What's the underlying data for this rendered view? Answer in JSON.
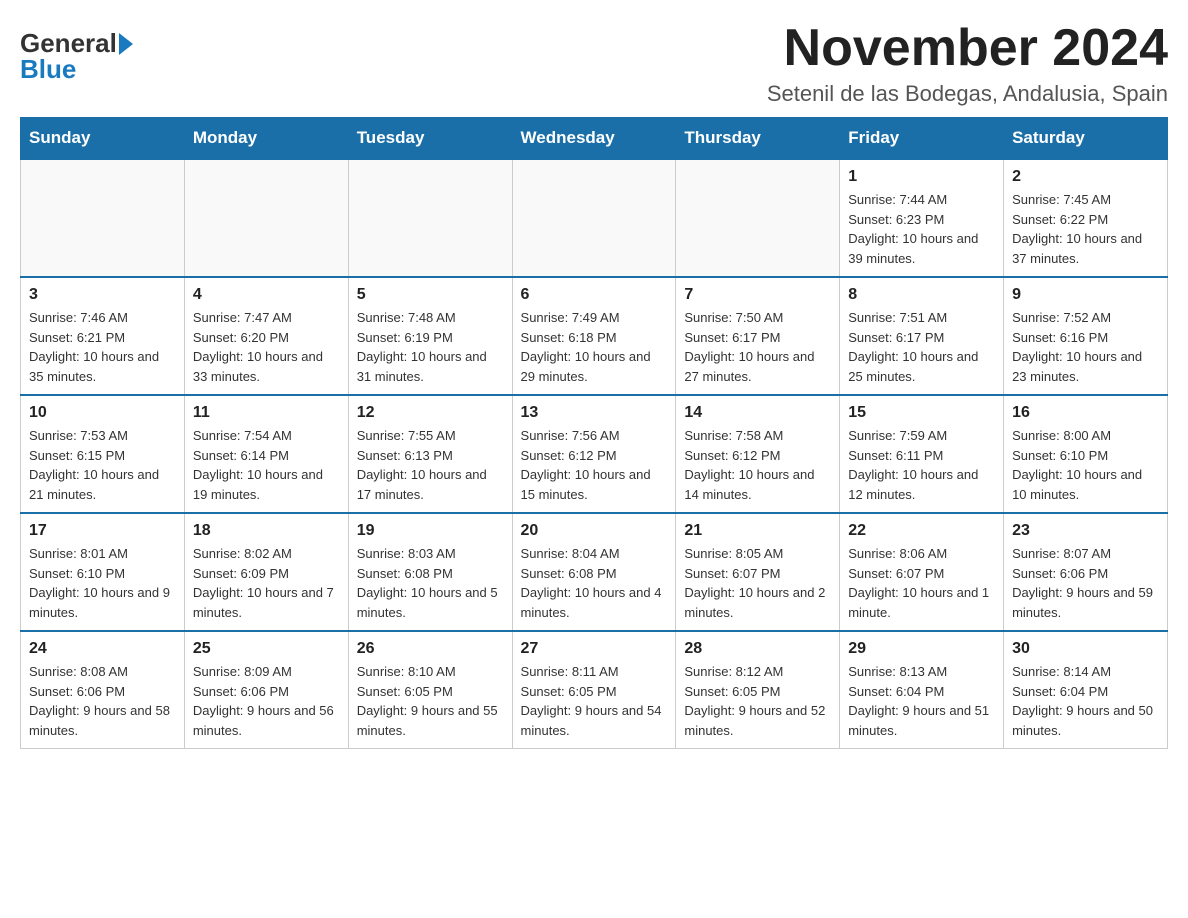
{
  "logo": {
    "general": "General",
    "blue": "Blue"
  },
  "title": "November 2024",
  "location": "Setenil de las Bodegas, Andalusia, Spain",
  "days_of_week": [
    "Sunday",
    "Monday",
    "Tuesday",
    "Wednesday",
    "Thursday",
    "Friday",
    "Saturday"
  ],
  "weeks": [
    [
      {
        "day": "",
        "info": ""
      },
      {
        "day": "",
        "info": ""
      },
      {
        "day": "",
        "info": ""
      },
      {
        "day": "",
        "info": ""
      },
      {
        "day": "",
        "info": ""
      },
      {
        "day": "1",
        "info": "Sunrise: 7:44 AM\nSunset: 6:23 PM\nDaylight: 10 hours and 39 minutes."
      },
      {
        "day": "2",
        "info": "Sunrise: 7:45 AM\nSunset: 6:22 PM\nDaylight: 10 hours and 37 minutes."
      }
    ],
    [
      {
        "day": "3",
        "info": "Sunrise: 7:46 AM\nSunset: 6:21 PM\nDaylight: 10 hours and 35 minutes."
      },
      {
        "day": "4",
        "info": "Sunrise: 7:47 AM\nSunset: 6:20 PM\nDaylight: 10 hours and 33 minutes."
      },
      {
        "day": "5",
        "info": "Sunrise: 7:48 AM\nSunset: 6:19 PM\nDaylight: 10 hours and 31 minutes."
      },
      {
        "day": "6",
        "info": "Sunrise: 7:49 AM\nSunset: 6:18 PM\nDaylight: 10 hours and 29 minutes."
      },
      {
        "day": "7",
        "info": "Sunrise: 7:50 AM\nSunset: 6:17 PM\nDaylight: 10 hours and 27 minutes."
      },
      {
        "day": "8",
        "info": "Sunrise: 7:51 AM\nSunset: 6:17 PM\nDaylight: 10 hours and 25 minutes."
      },
      {
        "day": "9",
        "info": "Sunrise: 7:52 AM\nSunset: 6:16 PM\nDaylight: 10 hours and 23 minutes."
      }
    ],
    [
      {
        "day": "10",
        "info": "Sunrise: 7:53 AM\nSunset: 6:15 PM\nDaylight: 10 hours and 21 minutes."
      },
      {
        "day": "11",
        "info": "Sunrise: 7:54 AM\nSunset: 6:14 PM\nDaylight: 10 hours and 19 minutes."
      },
      {
        "day": "12",
        "info": "Sunrise: 7:55 AM\nSunset: 6:13 PM\nDaylight: 10 hours and 17 minutes."
      },
      {
        "day": "13",
        "info": "Sunrise: 7:56 AM\nSunset: 6:12 PM\nDaylight: 10 hours and 15 minutes."
      },
      {
        "day": "14",
        "info": "Sunrise: 7:58 AM\nSunset: 6:12 PM\nDaylight: 10 hours and 14 minutes."
      },
      {
        "day": "15",
        "info": "Sunrise: 7:59 AM\nSunset: 6:11 PM\nDaylight: 10 hours and 12 minutes."
      },
      {
        "day": "16",
        "info": "Sunrise: 8:00 AM\nSunset: 6:10 PM\nDaylight: 10 hours and 10 minutes."
      }
    ],
    [
      {
        "day": "17",
        "info": "Sunrise: 8:01 AM\nSunset: 6:10 PM\nDaylight: 10 hours and 9 minutes."
      },
      {
        "day": "18",
        "info": "Sunrise: 8:02 AM\nSunset: 6:09 PM\nDaylight: 10 hours and 7 minutes."
      },
      {
        "day": "19",
        "info": "Sunrise: 8:03 AM\nSunset: 6:08 PM\nDaylight: 10 hours and 5 minutes."
      },
      {
        "day": "20",
        "info": "Sunrise: 8:04 AM\nSunset: 6:08 PM\nDaylight: 10 hours and 4 minutes."
      },
      {
        "day": "21",
        "info": "Sunrise: 8:05 AM\nSunset: 6:07 PM\nDaylight: 10 hours and 2 minutes."
      },
      {
        "day": "22",
        "info": "Sunrise: 8:06 AM\nSunset: 6:07 PM\nDaylight: 10 hours and 1 minute."
      },
      {
        "day": "23",
        "info": "Sunrise: 8:07 AM\nSunset: 6:06 PM\nDaylight: 9 hours and 59 minutes."
      }
    ],
    [
      {
        "day": "24",
        "info": "Sunrise: 8:08 AM\nSunset: 6:06 PM\nDaylight: 9 hours and 58 minutes."
      },
      {
        "day": "25",
        "info": "Sunrise: 8:09 AM\nSunset: 6:06 PM\nDaylight: 9 hours and 56 minutes."
      },
      {
        "day": "26",
        "info": "Sunrise: 8:10 AM\nSunset: 6:05 PM\nDaylight: 9 hours and 55 minutes."
      },
      {
        "day": "27",
        "info": "Sunrise: 8:11 AM\nSunset: 6:05 PM\nDaylight: 9 hours and 54 minutes."
      },
      {
        "day": "28",
        "info": "Sunrise: 8:12 AM\nSunset: 6:05 PM\nDaylight: 9 hours and 52 minutes."
      },
      {
        "day": "29",
        "info": "Sunrise: 8:13 AM\nSunset: 6:04 PM\nDaylight: 9 hours and 51 minutes."
      },
      {
        "day": "30",
        "info": "Sunrise: 8:14 AM\nSunset: 6:04 PM\nDaylight: 9 hours and 50 minutes."
      }
    ]
  ]
}
